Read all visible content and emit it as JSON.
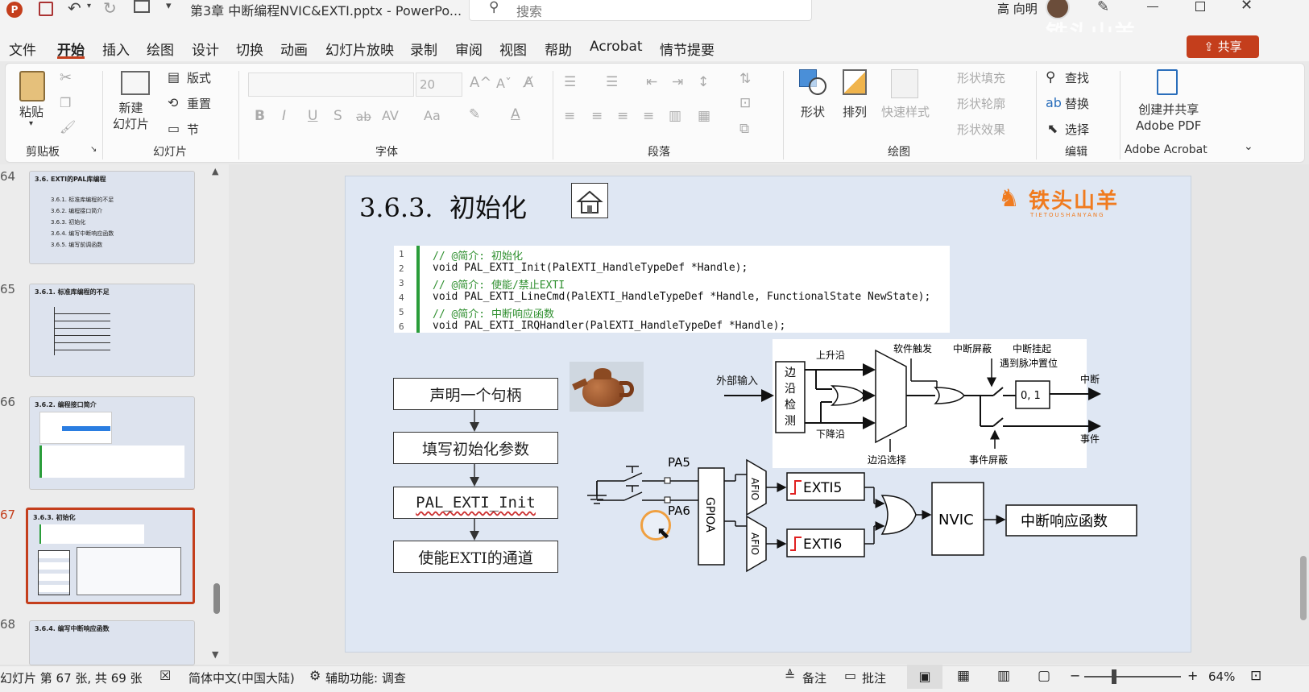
{
  "titlebar": {
    "app_icon": "P",
    "document_title": "第3章 中断编程NVIC&EXTI.pptx  -  PowerPo...",
    "search_placeholder": "搜索",
    "user_name": "高 向明",
    "share_label": "共享",
    "watermark": "铁头山羊"
  },
  "ribbon_tabs": [
    "文件",
    "开始",
    "插入",
    "绘图",
    "设计",
    "切换",
    "动画",
    "幻灯片放映",
    "录制",
    "审阅",
    "视图",
    "帮助",
    "Acrobat",
    "情节提要"
  ],
  "ribbon": {
    "clipboard": {
      "paste": "粘贴",
      "group": "剪贴板"
    },
    "slides": {
      "new_slide": "新建\n幻灯片",
      "layout": "版式",
      "reset": "重置",
      "section": "节",
      "group": "幻灯片"
    },
    "font": {
      "font_size": "20",
      "bold": "B",
      "italic": "I",
      "underline": "U",
      "shadow": "S",
      "strike": "ab",
      "spacing": "AV",
      "case": "Aa",
      "group": "字体"
    },
    "paragraph": {
      "group": "段落"
    },
    "drawing": {
      "shapes": "形状",
      "arrange": "排列",
      "quick_styles": "快速样式",
      "fill": "形状填充",
      "outline": "形状轮廓",
      "effects": "形状效果",
      "group": "绘图"
    },
    "editing": {
      "find": "查找",
      "replace": "替换",
      "select": "选择",
      "group": "编辑"
    },
    "acrobat": {
      "create": "创建并共享\nAdobe PDF",
      "group": "Adobe Acrobat"
    }
  },
  "thumbnails": [
    {
      "num": "64",
      "title": "3.6. EXTI的PAL库编程"
    },
    {
      "num": "65",
      "title": "3.6.1. 标准库编程的不足"
    },
    {
      "num": "66",
      "title": "3.6.2. 编程接口简介"
    },
    {
      "num": "67",
      "title": "3.6.3. 初始化"
    },
    {
      "num": "68",
      "title": "3.6.4. 编写中断响应函数"
    }
  ],
  "thumb64_items": [
    "3.6.1. 标准库编程的不足",
    "3.6.2. 编程接口简介",
    "3.6.3. 初始化",
    "3.6.4. 编写中断响应函数",
    "3.6.5. 编写前调函数"
  ],
  "slide": {
    "title": "3.6.3.  初始化",
    "logo_text": "铁头山羊",
    "logo_sub": "TIETOUSHANYANG",
    "code": [
      {
        "n": "1",
        "text": "// @简介: 初始化",
        "comment": true
      },
      {
        "n": "2",
        "text": "void PAL_EXTI_Init(PalEXTI_HandleTypeDef *Handle);",
        "comment": false
      },
      {
        "n": "3",
        "text": "// @简介: 使能/禁止EXTI",
        "comment": true
      },
      {
        "n": "4",
        "text": "void PAL_EXTI_LineCmd(PalEXTI_HandleTypeDef *Handle, FunctionalState NewState);",
        "comment": false
      },
      {
        "n": "5",
        "text": "// @简介: 中断响应函数",
        "comment": true
      },
      {
        "n": "6",
        "text": "void PAL_EXTI_IRQHandler(PalEXTI_HandleTypeDef *Handle);",
        "comment": false
      }
    ],
    "flow": [
      "声明一个句柄",
      "填写初始化参数",
      "PAL_EXTI_Init",
      "使能EXTI的通道"
    ],
    "diagram": {
      "ext_input": "外部输入",
      "edge_detect": [
        "边",
        "沿",
        "检",
        "测"
      ],
      "rising": "上升沿",
      "falling": "下降沿",
      "edge_select": "边沿选择",
      "sw_trigger": "软件触发",
      "int_mask": "中断屏蔽",
      "pending1": "中断挂起",
      "pending2": "遇到脉冲置位",
      "pending_val": "0, 1",
      "interrupt": "中断",
      "event": "事件",
      "event_mask": "事件屏蔽"
    },
    "circuit": {
      "pa5": "PA5",
      "pa6": "PA6",
      "gpioa": "GPIOA",
      "afio": "AFIO",
      "exti5": "EXTI5",
      "exti6": "EXTI6",
      "nvic": "NVIC",
      "handler": "中断响应函数"
    }
  },
  "statusbar": {
    "slide_info": "幻灯片 第 67 张, 共 69 张",
    "language": "简体中文(中国大陆)",
    "accessibility": "辅助功能: 调查",
    "notes": "备注",
    "comments": "批注",
    "zoom": "64%"
  }
}
